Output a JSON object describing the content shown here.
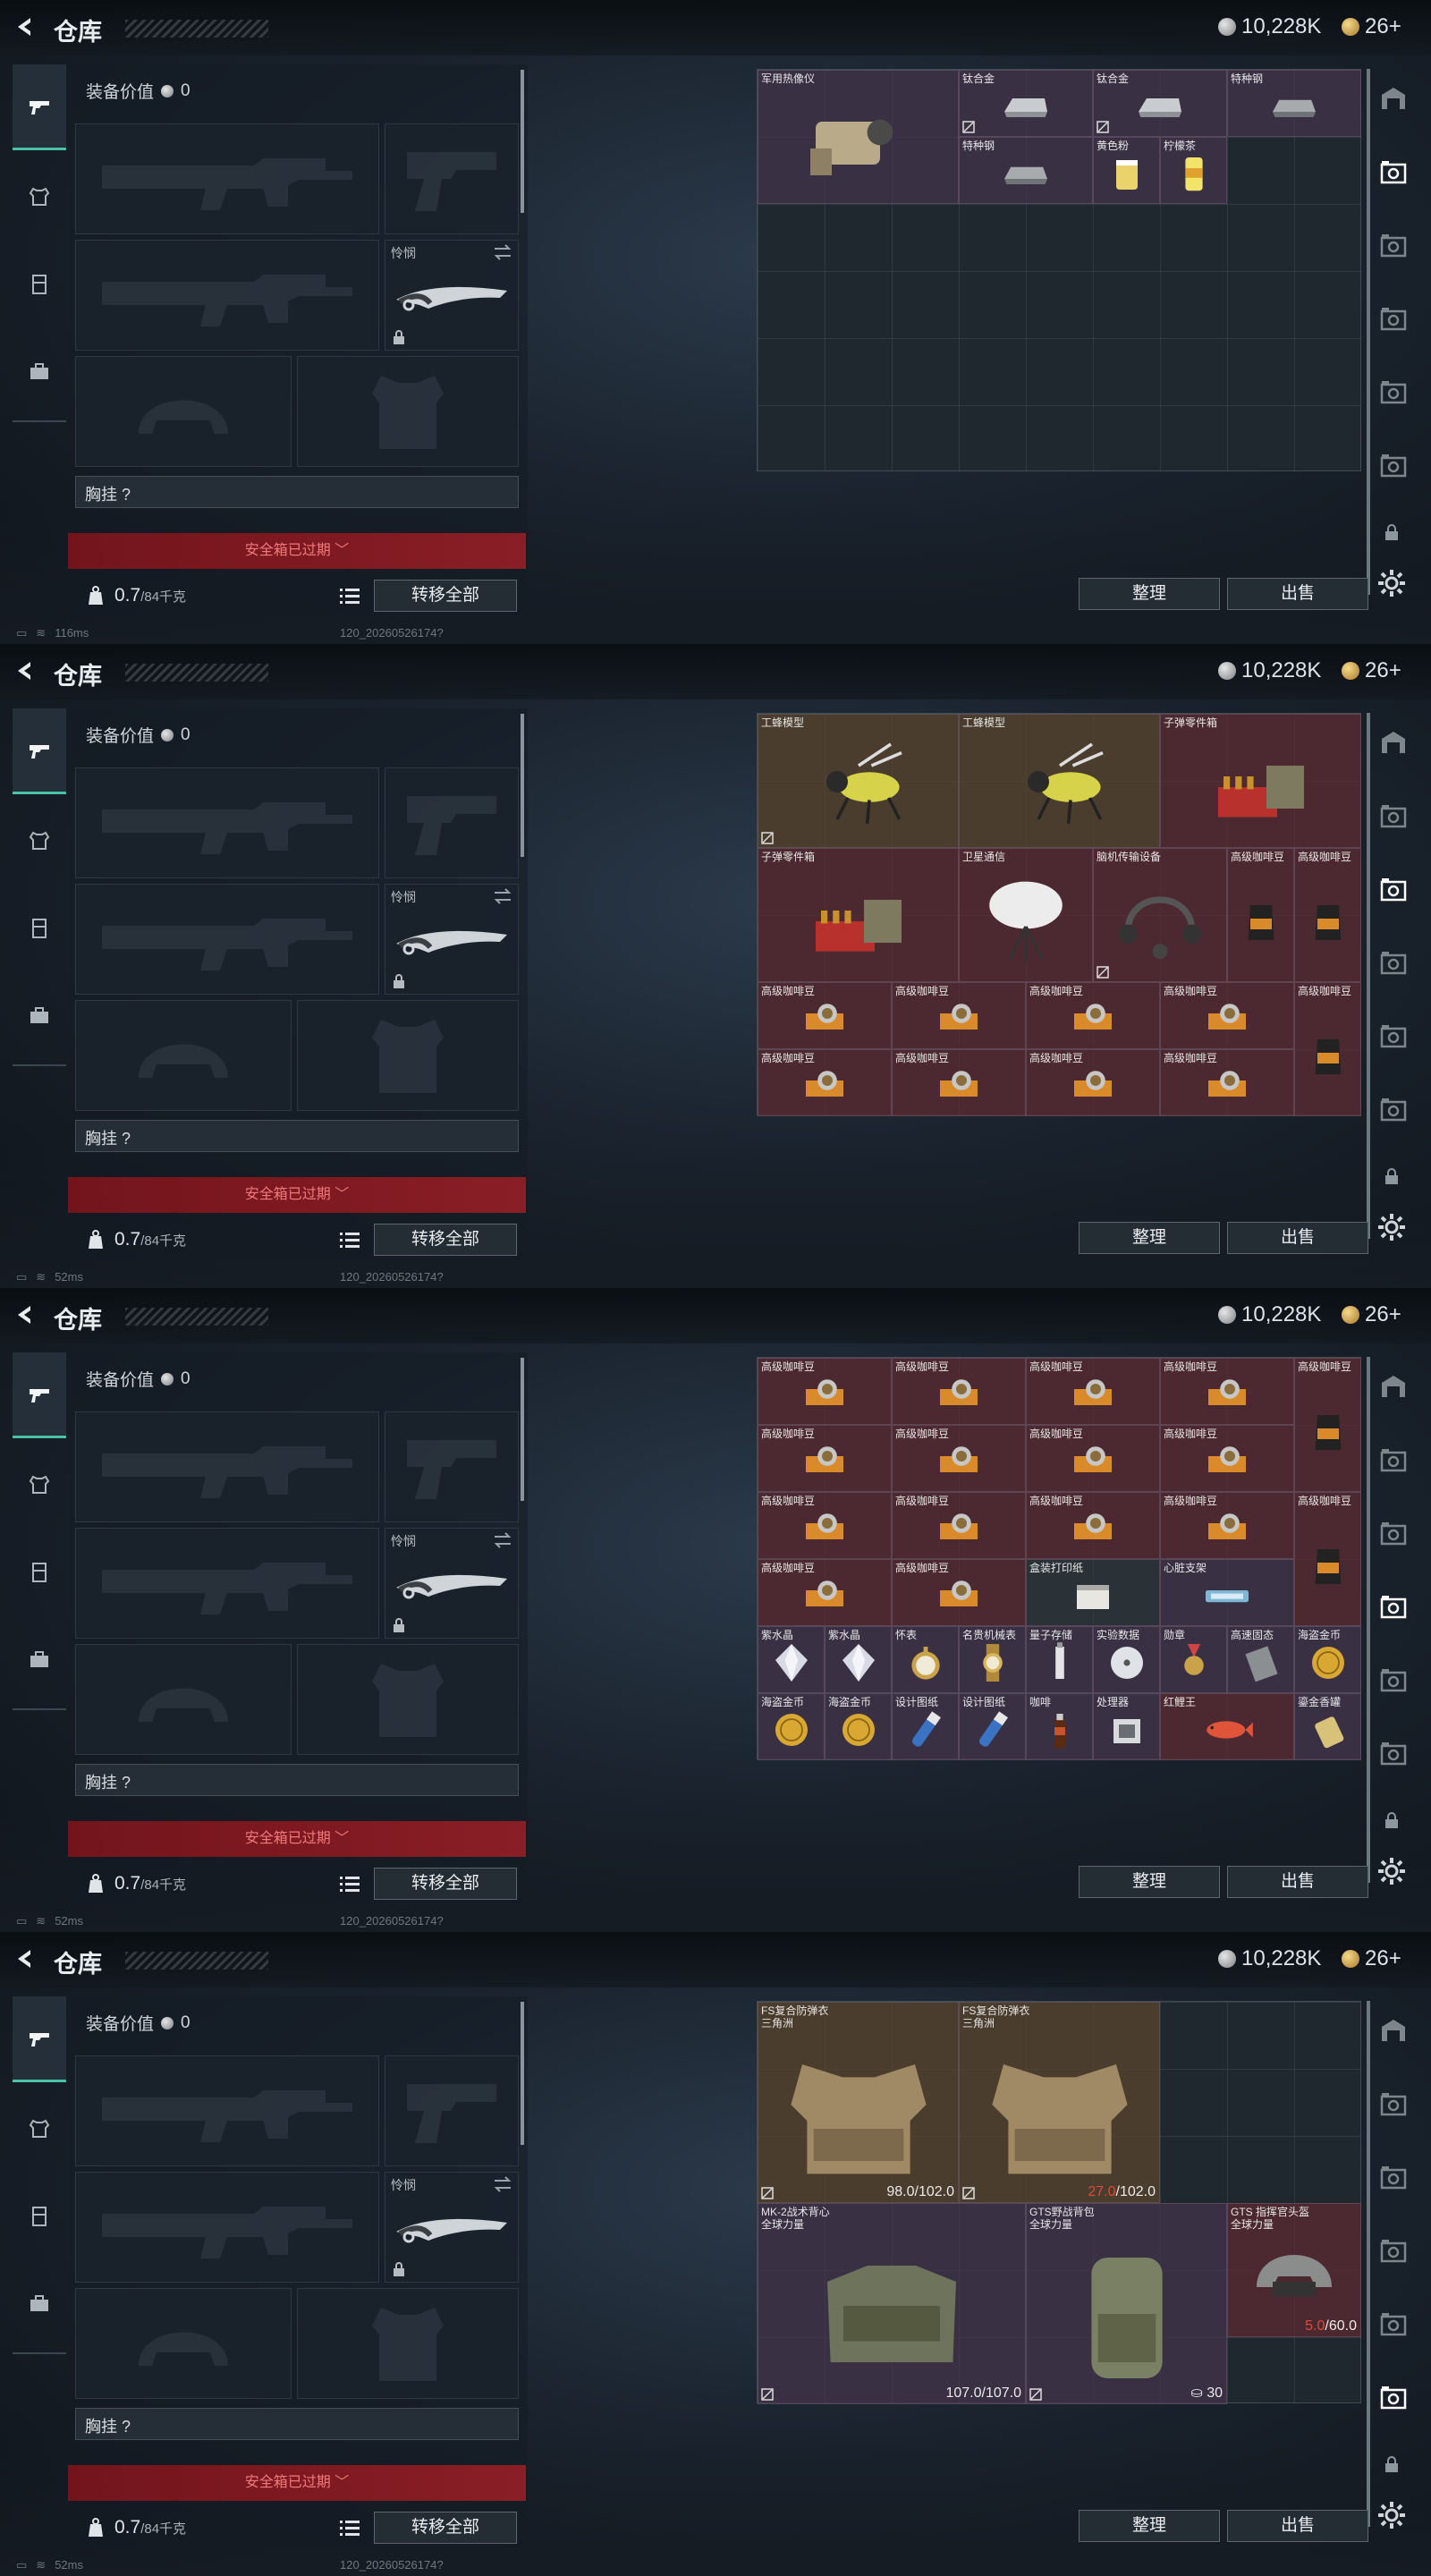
{
  "frames": [
    {
      "title": "仓库",
      "currency": {
        "silver": "10,228K",
        "gold": "26+"
      },
      "equip_value_label": "装备价值",
      "equip_value": "0",
      "melee_label": "怜悯",
      "chest_label": "胸挂 ?",
      "safe_label": "安全箱已过期",
      "weight": "0.7",
      "weight_max": "/84千克",
      "transfer_all": "转移全部",
      "sort_label": "整理",
      "sell_label": "出售",
      "ping": "116ms",
      "session_id": "120_20260526174?",
      "active_rail": 1,
      "grid_rows": 6,
      "items": [
        {
          "name": "军用热像仪",
          "col": 0,
          "row": 0,
          "w": 3,
          "h": 2,
          "color": "purple",
          "icon": "thermal-camera",
          "mark": false
        },
        {
          "name": "钛合金",
          "col": 3,
          "row": 0,
          "w": 2,
          "h": 1,
          "color": "purple",
          "icon": "titanium-ingot",
          "mark": true
        },
        {
          "name": "钛合金",
          "col": 5,
          "row": 0,
          "w": 2,
          "h": 1,
          "color": "purple",
          "icon": "titanium-ingot",
          "mark": true
        },
        {
          "name": "特种钢",
          "col": 7,
          "row": 0,
          "w": 2,
          "h": 1,
          "color": "purple",
          "icon": "steel-ingot",
          "mark": false
        },
        {
          "name": "特种钢",
          "col": 3,
          "row": 1,
          "w": 2,
          "h": 1,
          "color": "purple",
          "icon": "steel-ingot",
          "mark": false
        },
        {
          "name": "黄色粉",
          "col": 5,
          "row": 1,
          "w": 1,
          "h": 1,
          "color": "purple",
          "icon": "yellow-powder",
          "mark": false
        },
        {
          "name": "柠檬茶",
          "col": 6,
          "row": 1,
          "w": 1,
          "h": 1,
          "color": "purple",
          "icon": "lemon-tea",
          "mark": false
        }
      ]
    },
    {
      "title": "仓库",
      "currency": {
        "silver": "10,228K",
        "gold": "26+"
      },
      "equip_value_label": "装备价值",
      "equip_value": "0",
      "melee_label": "怜悯",
      "chest_label": "胸挂 ?",
      "safe_label": "安全箱已过期",
      "weight": "0.7",
      "weight_max": "/84千克",
      "transfer_all": "转移全部",
      "sort_label": "整理",
      "sell_label": "出售",
      "ping": "52ms",
      "session_id": "120_20260526174?",
      "active_rail": 2,
      "grid_rows": 6,
      "items": [
        {
          "name": "工蜂模型",
          "col": 0,
          "row": 0,
          "w": 3,
          "h": 2,
          "color": "gold",
          "icon": "wasp-model",
          "mark": true
        },
        {
          "name": "工蜂模型",
          "col": 3,
          "row": 0,
          "w": 3,
          "h": 2,
          "color": "gold",
          "icon": "wasp-model",
          "mark": false
        },
        {
          "name": "子弹零件箱",
          "col": 6,
          "row": 0,
          "w": 3,
          "h": 2,
          "color": "red",
          "icon": "ammo-parts-box",
          "mark": false
        },
        {
          "name": "子弹零件箱",
          "col": 0,
          "row": 2,
          "w": 3,
          "h": 2,
          "color": "red",
          "icon": "ammo-parts-box",
          "mark": false
        },
        {
          "name": "卫星通信",
          "col": 3,
          "row": 2,
          "w": 2,
          "h": 2,
          "color": "red",
          "icon": "satellite-dish",
          "mark": false
        },
        {
          "name": "脑机传输设备",
          "col": 5,
          "row": 2,
          "w": 2,
          "h": 2,
          "color": "red",
          "icon": "brain-headset",
          "mark": true
        },
        {
          "name": "高级咖啡豆",
          "col": 7,
          "row": 2,
          "w": 1,
          "h": 2,
          "color": "red",
          "icon": "coffee-bag",
          "mark": false
        },
        {
          "name": "高级咖啡豆",
          "col": 8,
          "row": 2,
          "w": 1,
          "h": 2,
          "color": "red",
          "icon": "coffee-bag",
          "mark": false
        },
        {
          "name": "高级咖啡豆",
          "col": 0,
          "row": 4,
          "w": 2,
          "h": 1,
          "color": "red",
          "icon": "coffee-box",
          "mark": false
        },
        {
          "name": "高级咖啡豆",
          "col": 2,
          "row": 4,
          "w": 2,
          "h": 1,
          "color": "red",
          "icon": "coffee-box",
          "mark": false
        },
        {
          "name": "高级咖啡豆",
          "col": 4,
          "row": 4,
          "w": 2,
          "h": 1,
          "color": "red",
          "icon": "coffee-box",
          "mark": false
        },
        {
          "name": "高级咖啡豆",
          "col": 6,
          "row": 4,
          "w": 2,
          "h": 1,
          "color": "red",
          "icon": "coffee-box",
          "mark": false
        },
        {
          "name": "高级咖啡豆",
          "col": 8,
          "row": 4,
          "w": 1,
          "h": 2,
          "color": "red",
          "icon": "coffee-bag",
          "mark": false
        },
        {
          "name": "高级咖啡豆",
          "col": 0,
          "row": 5,
          "w": 2,
          "h": 1,
          "color": "red",
          "icon": "coffee-box",
          "mark": false
        },
        {
          "name": "高级咖啡豆",
          "col": 2,
          "row": 5,
          "w": 2,
          "h": 1,
          "color": "red",
          "icon": "coffee-box",
          "mark": false
        },
        {
          "name": "高级咖啡豆",
          "col": 4,
          "row": 5,
          "w": 2,
          "h": 1,
          "color": "red",
          "icon": "coffee-box",
          "mark": false
        },
        {
          "name": "高级咖啡豆",
          "col": 6,
          "row": 5,
          "w": 2,
          "h": 1,
          "color": "red",
          "icon": "coffee-box",
          "mark": false
        }
      ]
    },
    {
      "title": "仓库",
      "currency": {
        "silver": "10,228K",
        "gold": "26+"
      },
      "equip_value_label": "装备价值",
      "equip_value": "0",
      "melee_label": "怜悯",
      "chest_label": "胸挂 ?",
      "safe_label": "安全箱已过期",
      "weight": "0.7",
      "weight_max": "/84千克",
      "transfer_all": "转移全部",
      "sort_label": "整理",
      "sell_label": "出售",
      "ping": "52ms",
      "session_id": "120_20260526174?",
      "active_rail": 3,
      "grid_rows": 6,
      "items": [
        {
          "name": "高级咖啡豆",
          "col": 0,
          "row": 0,
          "w": 2,
          "h": 1,
          "color": "red",
          "icon": "coffee-box",
          "mark": false
        },
        {
          "name": "高级咖啡豆",
          "col": 2,
          "row": 0,
          "w": 2,
          "h": 1,
          "color": "red",
          "icon": "coffee-box",
          "mark": false
        },
        {
          "name": "高级咖啡豆",
          "col": 4,
          "row": 0,
          "w": 2,
          "h": 1,
          "color": "red",
          "icon": "coffee-box",
          "mark": false
        },
        {
          "name": "高级咖啡豆",
          "col": 6,
          "row": 0,
          "w": 2,
          "h": 1,
          "color": "red",
          "icon": "coffee-box",
          "mark": false
        },
        {
          "name": "高级咖啡豆",
          "col": 8,
          "row": 0,
          "w": 1,
          "h": 2,
          "color": "red",
          "icon": "coffee-bag",
          "mark": false
        },
        {
          "name": "高级咖啡豆",
          "col": 0,
          "row": 1,
          "w": 2,
          "h": 1,
          "color": "red",
          "icon": "coffee-box",
          "mark": false
        },
        {
          "name": "高级咖啡豆",
          "col": 2,
          "row": 1,
          "w": 2,
          "h": 1,
          "color": "red",
          "icon": "coffee-box",
          "mark": false
        },
        {
          "name": "高级咖啡豆",
          "col": 4,
          "row": 1,
          "w": 2,
          "h": 1,
          "color": "red",
          "icon": "coffee-box",
          "mark": false
        },
        {
          "name": "高级咖啡豆",
          "col": 6,
          "row": 1,
          "w": 2,
          "h": 1,
          "color": "red",
          "icon": "coffee-box",
          "mark": false
        },
        {
          "name": "高级咖啡豆",
          "col": 0,
          "row": 2,
          "w": 2,
          "h": 1,
          "color": "red",
          "icon": "coffee-box",
          "mark": false
        },
        {
          "name": "高级咖啡豆",
          "col": 2,
          "row": 2,
          "w": 2,
          "h": 1,
          "color": "red",
          "icon": "coffee-box",
          "mark": false
        },
        {
          "name": "高级咖啡豆",
          "col": 4,
          "row": 2,
          "w": 2,
          "h": 1,
          "color": "red",
          "icon": "coffee-box",
          "mark": false
        },
        {
          "name": "高级咖啡豆",
          "col": 6,
          "row": 2,
          "w": 2,
          "h": 1,
          "color": "red",
          "icon": "coffee-box",
          "mark": false
        },
        {
          "name": "高级咖啡豆",
          "col": 8,
          "row": 2,
          "w": 1,
          "h": 2,
          "color": "red",
          "icon": "coffee-bag",
          "mark": false
        },
        {
          "name": "高级咖啡豆",
          "col": 0,
          "row": 3,
          "w": 2,
          "h": 1,
          "color": "red",
          "icon": "coffee-box",
          "mark": false
        },
        {
          "name": "高级咖啡豆",
          "col": 2,
          "row": 3,
          "w": 2,
          "h": 1,
          "color": "red",
          "icon": "coffee-box",
          "mark": false
        },
        {
          "name": "盒装打印纸",
          "col": 4,
          "row": 3,
          "w": 2,
          "h": 1,
          "color": "gray",
          "icon": "paper-box",
          "mark": false
        },
        {
          "name": "心脏支架",
          "col": 6,
          "row": 3,
          "w": 2,
          "h": 1,
          "color": "purple",
          "icon": "heart-stent",
          "mark": false
        },
        {
          "name": "紫水晶",
          "col": 0,
          "row": 4,
          "w": 1,
          "h": 1,
          "color": "purple",
          "icon": "crystal",
          "mark": false
        },
        {
          "name": "紫水晶",
          "col": 1,
          "row": 4,
          "w": 1,
          "h": 1,
          "color": "purple",
          "icon": "crystal",
          "mark": false
        },
        {
          "name": "怀表",
          "col": 2,
          "row": 4,
          "w": 1,
          "h": 1,
          "color": "purple",
          "icon": "pocket-watch",
          "mark": false
        },
        {
          "name": "名贵机械表",
          "col": 3,
          "row": 4,
          "w": 1,
          "h": 1,
          "color": "purple",
          "icon": "wristwatch",
          "mark": false
        },
        {
          "name": "量子存储",
          "col": 4,
          "row": 4,
          "w": 1,
          "h": 1,
          "color": "purple",
          "icon": "usb-drive",
          "mark": false
        },
        {
          "name": "实验数据",
          "col": 5,
          "row": 4,
          "w": 1,
          "h": 1,
          "color": "purple",
          "icon": "disc",
          "mark": false
        },
        {
          "name": "勋章",
          "col": 6,
          "row": 4,
          "w": 1,
          "h": 1,
          "color": "purple",
          "icon": "medal",
          "mark": false
        },
        {
          "name": "高速固态",
          "col": 7,
          "row": 4,
          "w": 1,
          "h": 1,
          "color": "purple",
          "icon": "ssd",
          "mark": false
        },
        {
          "name": "海盗金币",
          "col": 8,
          "row": 4,
          "w": 1,
          "h": 1,
          "color": "purple",
          "icon": "gold-coin",
          "mark": false
        },
        {
          "name": "海盗金币",
          "col": 0,
          "row": 5,
          "w": 1,
          "h": 1,
          "color": "purple",
          "icon": "gold-coin",
          "mark": false
        },
        {
          "name": "海盗金币",
          "col": 1,
          "row": 5,
          "w": 1,
          "h": 1,
          "color": "purple",
          "icon": "gold-coin",
          "mark": false
        },
        {
          "name": "设计图纸",
          "col": 2,
          "row": 5,
          "w": 1,
          "h": 1,
          "color": "purple",
          "icon": "blueprint",
          "mark": false
        },
        {
          "name": "设计图纸",
          "col": 3,
          "row": 5,
          "w": 1,
          "h": 1,
          "color": "purple",
          "icon": "blueprint",
          "mark": false
        },
        {
          "name": "咖啡",
          "col": 4,
          "row": 5,
          "w": 1,
          "h": 1,
          "color": "purple",
          "icon": "coffee-bottle",
          "mark": false
        },
        {
          "name": "处理器",
          "col": 5,
          "row": 5,
          "w": 1,
          "h": 1,
          "color": "purple",
          "icon": "processor",
          "mark": false
        },
        {
          "name": "红鲤王",
          "col": 6,
          "row": 5,
          "w": 2,
          "h": 1,
          "color": "red",
          "icon": "red-carp",
          "mark": false
        },
        {
          "name": "鎏金香罐",
          "col": 8,
          "row": 5,
          "w": 1,
          "h": 1,
          "color": "purple",
          "icon": "incense-jar",
          "mark": false
        }
      ]
    },
    {
      "title": "仓库",
      "currency": {
        "silver": "10,228K",
        "gold": "26+"
      },
      "equip_value_label": "装备价值",
      "equip_value": "0",
      "melee_label": "怜悯",
      "chest_label": "胸挂 ?",
      "safe_label": "安全箱已过期",
      "weight": "0.7",
      "weight_max": "/84千克",
      "transfer_all": "转移全部",
      "sort_label": "整理",
      "sell_label": "出售",
      "ping": "52ms",
      "session_id": "120_20260526174?",
      "active_rail": 5,
      "grid_rows": 6,
      "items": [
        {
          "name": "FS复合防弹衣\n三角洲",
          "col": 0,
          "row": 0,
          "w": 3,
          "h": 3,
          "color": "gold",
          "icon": "body-armor",
          "mark": true,
          "dur": "98.0",
          "dur_max": "/102.0",
          "low": false
        },
        {
          "name": "FS复合防弹衣\n三角洲",
          "col": 3,
          "row": 0,
          "w": 3,
          "h": 3,
          "color": "gold",
          "icon": "body-armor",
          "mark": true,
          "dur": "27.0",
          "dur_max": "/102.0",
          "low": true
        },
        {
          "name": "MK-2战术背心\n全球力量",
          "col": 0,
          "row": 3,
          "w": 4,
          "h": 3,
          "color": "purple",
          "icon": "tactical-vest",
          "mark": true,
          "dur": "107.0",
          "dur_max": "/107.0",
          "low": false
        },
        {
          "name": "GTS野战背包\n全球力量",
          "col": 4,
          "row": 3,
          "w": 3,
          "h": 3,
          "color": "purple",
          "icon": "backpack",
          "mark": true,
          "dur": "",
          "dur_max": "",
          "low": false,
          "capacity": "30"
        },
        {
          "name": "GTS 指挥官头盔\n全球力量",
          "col": 7,
          "row": 3,
          "w": 2,
          "h": 2,
          "color": "red",
          "icon": "helmet",
          "mark": false,
          "dur": "5.0",
          "dur_max": "/60.0",
          "low": true
        }
      ]
    }
  ]
}
